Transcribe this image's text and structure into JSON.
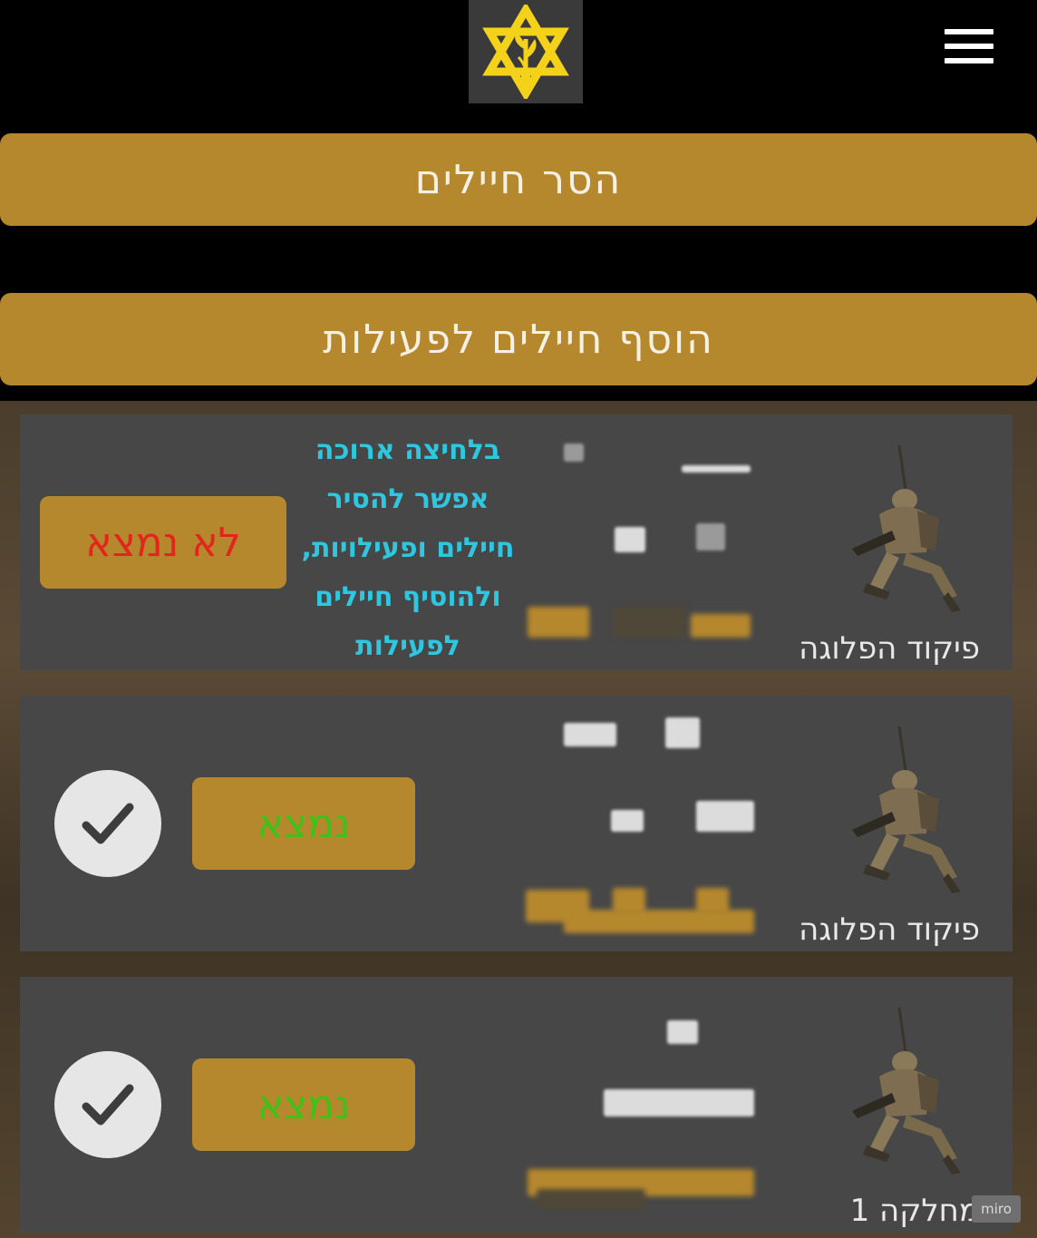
{
  "header": {
    "logo_icon": "idf-star-emblem-icon",
    "menu_icon": "hamburger-menu-icon"
  },
  "actions": {
    "remove_soldiers": "הסר חיילים",
    "add_soldiers_to_activity": "הוסף חיילים לפעילות"
  },
  "hint": {
    "lines": [
      "בלחיצה ארוכה",
      "אפשר להסיר",
      "חיילים ופעילויות,",
      "ולהוסיף חיילים",
      "לפעילות"
    ]
  },
  "soldiers": [
    {
      "unit": "פיקוד הפלוגה",
      "status": "לא נמצא",
      "status_color": "#e3261b",
      "checked": false
    },
    {
      "unit": "פיקוד הפלוגה",
      "status": "נמצא",
      "status_color": "#3ec21a",
      "checked": true
    },
    {
      "unit": "מחלקה 1",
      "status": "נמצא",
      "status_color": "#3ec21a",
      "checked": true
    }
  ],
  "watermark": "miro"
}
